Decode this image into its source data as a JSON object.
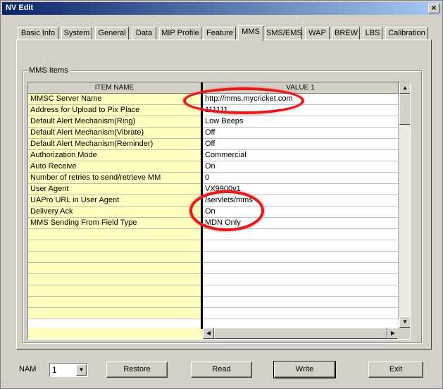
{
  "window": {
    "title": "NV Edit",
    "close_glyph": "×"
  },
  "tabs": [
    {
      "label": "Basic Info"
    },
    {
      "label": "System"
    },
    {
      "label": "General"
    },
    {
      "label": "Data"
    },
    {
      "label": "MIP Profile"
    },
    {
      "label": "Feature"
    },
    {
      "label": "MMS"
    },
    {
      "label": "SMS/EMS"
    },
    {
      "label": "WAP"
    },
    {
      "label": "BREW"
    },
    {
      "label": "LBS"
    },
    {
      "label": "Calibration"
    }
  ],
  "active_tab": "MMS",
  "group": {
    "label": "MMS Items"
  },
  "grid": {
    "headers": {
      "name": "ITEM NAME",
      "value": "VALUE 1"
    },
    "rows": [
      {
        "name": "MMSC Server Name",
        "value": "http://mms.mycricket.com"
      },
      {
        "name": "Address for Upload to Pix Place",
        "value": "111111"
      },
      {
        "name": "Default Alert Mechanism(Ring)",
        "value": "Low Beeps"
      },
      {
        "name": "Default Alert Mechanism(Vibrate)",
        "value": "Off"
      },
      {
        "name": "Default Alert Mechanism(Reminder)",
        "value": "Off"
      },
      {
        "name": "Authorization Mode",
        "value": "Commercial"
      },
      {
        "name": "Auto Receive",
        "value": "On"
      },
      {
        "name": "Number of retries to send/retrieve MM",
        "value": "0"
      },
      {
        "name": "User Agent",
        "value": "VX9900v1"
      },
      {
        "name": "UAPro URL in User Agent",
        "value": "/servlets/mms"
      },
      {
        "name": "Delivery Ack",
        "value": "On"
      },
      {
        "name": "MMS Sending From Field Type",
        "value": "MDN Only"
      }
    ]
  },
  "bottom": {
    "nam_label": "NAM",
    "nam_value": "1",
    "restore_label": "Restore",
    "read_label": "Read",
    "write_label": "Write",
    "exit_label": "Exit"
  },
  "colors": {
    "annotation": "#e81818",
    "name_column": "#ffffc0",
    "titlebar": "#0a246a"
  }
}
